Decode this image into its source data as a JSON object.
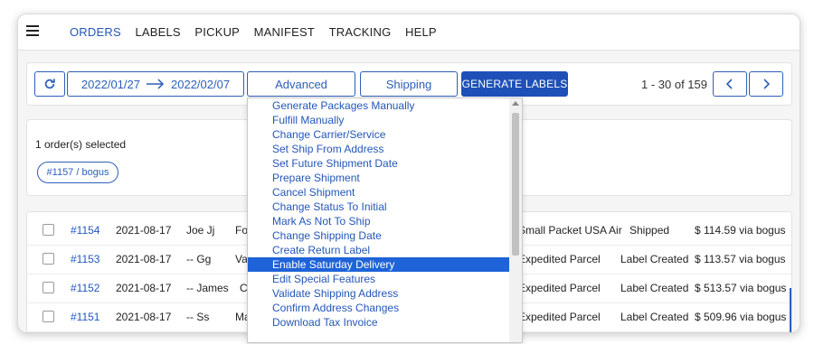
{
  "nav": {
    "links": [
      "ORDERS",
      "LABELS",
      "PICKUP",
      "MANIFEST",
      "TRACKING",
      "HELP"
    ]
  },
  "toolbar": {
    "date_from": "2022/01/27",
    "date_to": "2022/02/07",
    "advanced_label": "Advanced",
    "shipping_label": "Shipping",
    "generate_label": "GENERATE LABELS",
    "pager_text": "1 - 30 of 159"
  },
  "selection": {
    "count_text": "1 order(s) selected",
    "chip": "#1157 / bogus"
  },
  "orders": [
    {
      "id": "#1154",
      "date": "2021-08-17",
      "customer": "Joe Jj",
      "c4": "Fo",
      "service": "Small Packet USA Air",
      "status": "Shipped",
      "amount": "$ 114.59 via bogus"
    },
    {
      "id": "#1153",
      "date": "2021-08-17",
      "customer": "-- Gg",
      "c4": "Va",
      "service": "Expedited Parcel",
      "status": "Label Created",
      "amount": "$ 113.57 via bogus"
    },
    {
      "id": "#1152",
      "date": "2021-08-17",
      "customer": "-- James",
      "c4": "Co",
      "service": "Expedited Parcel",
      "status": "Label Created",
      "amount": "$ 513.57 via bogus"
    },
    {
      "id": "#1151",
      "date": "2021-08-17",
      "customer": "-- Ss",
      "c4": "Ma",
      "service": "Expedited Parcel",
      "status": "Label Created",
      "amount": "$ 509.96 via bogus"
    }
  ],
  "menu": {
    "items": [
      "Generate Packages Manually",
      "Fulfill Manually",
      "Change Carrier/Service",
      "Set Ship From Address",
      "Set Future Shipment Date",
      "Prepare Shipment",
      "Cancel Shipment",
      "Change Status To Initial",
      "Mark As Not To Ship",
      "Change Shipping Date",
      "Create Return Label",
      "Enable Saturday Delivery",
      "Edit Special Features",
      "Validate Shipping Address",
      "Confirm Address Changes",
      "Download Tax Invoice"
    ],
    "highlighted": "Enable Saturday Delivery"
  },
  "colors": {
    "accent": "#2d5fb8",
    "primary_button": "#1e50b8",
    "menu_highlight": "#1e63d8",
    "link": "#1f56c2"
  }
}
